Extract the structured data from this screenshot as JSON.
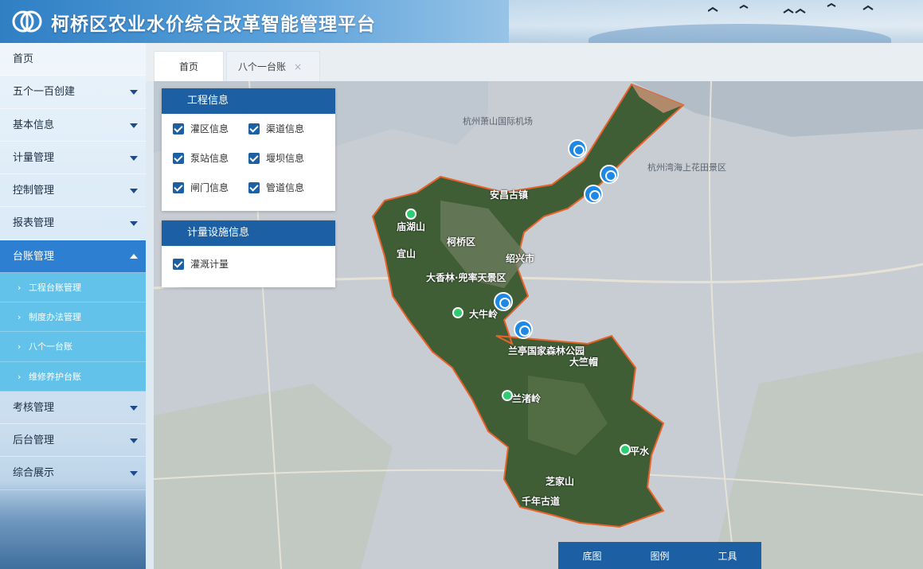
{
  "header": {
    "title": "柯桥区农业水价综合改革智能管理平台",
    "logo_icon": "water-drop-logo-icon"
  },
  "sidebar": {
    "items": [
      {
        "label": "首页"
      },
      {
        "label": "五个一百创建"
      },
      {
        "label": "基本信息"
      },
      {
        "label": "计量管理"
      },
      {
        "label": "控制管理"
      },
      {
        "label": "报表管理"
      },
      {
        "label": "台账管理"
      }
    ],
    "sub_items": [
      {
        "label": "工程台账管理"
      },
      {
        "label": "制度办法管理"
      },
      {
        "label": "八个一台账"
      },
      {
        "label": "维修养护台账"
      }
    ],
    "items_after": [
      {
        "label": "考核管理"
      },
      {
        "label": "后台管理"
      },
      {
        "label": "综合展示"
      }
    ],
    "colors": {
      "active": "#2d7fd1",
      "sub_bg": "#63c2ea"
    }
  },
  "tabs": [
    {
      "label": "首页"
    },
    {
      "label": "八个一台账",
      "close": "×"
    }
  ],
  "panels": {
    "engineering": {
      "title": "工程信息",
      "options": [
        "灌区信息",
        "渠道信息",
        "泵站信息",
        "堰坝信息",
        "闸门信息",
        "管道信息"
      ]
    },
    "metering": {
      "title": "计量设施信息",
      "options": [
        "灌溉计量"
      ]
    },
    "header_color": "#1c5fa2"
  },
  "map": {
    "labels": {
      "district": "柯桥区",
      "anchang": "安昌古镇",
      "airport": "杭州萧山国际机场",
      "shaoxing": "绍兴市",
      "dayang": "大香林·兜率天景区",
      "lanting": "兰亭国家森林公园",
      "daniuling": "大牛岭",
      "lanzhuling": "兰渚岭",
      "hushan": "庙湖山",
      "yishan": "宜山",
      "dazhunao": "大竺帽",
      "zhijiashan": "芝家山",
      "jingdong": "平水",
      "qiannian": "千年古道",
      "xiaoshan": "杭州湾海上花田景区"
    }
  },
  "toolbar": {
    "basemap": "底图",
    "legend": "图例",
    "tools": "工具"
  }
}
